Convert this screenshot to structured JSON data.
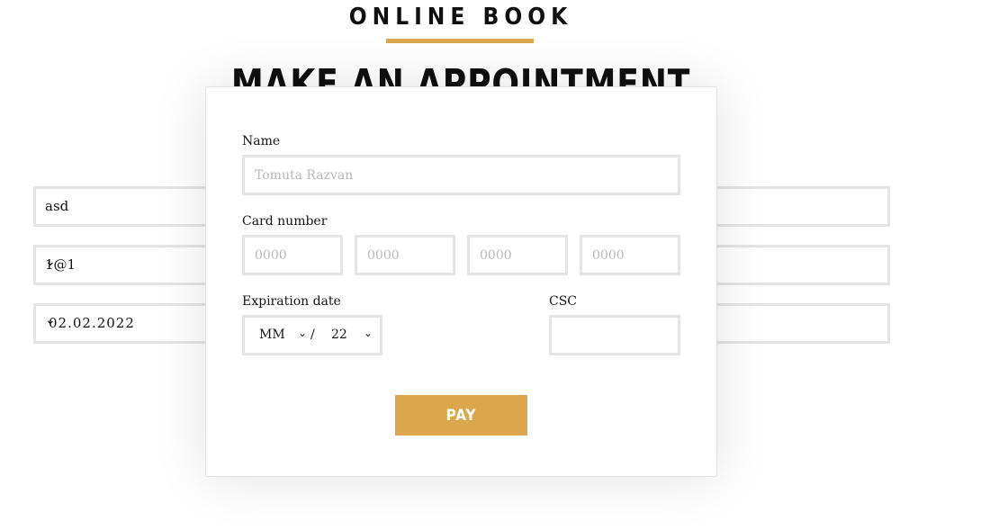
{
  "background": {
    "title": "ONLINE BOOK",
    "heading": "MAKE AN APPOINTMENT",
    "fields": {
      "name_value": "asd",
      "email_value": "1@1",
      "date_value": "02.02.2022"
    },
    "accent_color": "#d9a64b"
  },
  "modal": {
    "name_label": "Name",
    "name_placeholder": "Tomuta Razvan",
    "card_label": "Card number",
    "card_placeholders": [
      "0000",
      "0000",
      "0000",
      "0000"
    ],
    "expiration_label": "Expiration date",
    "expiration_month": "MM",
    "expiration_separator": "/",
    "expiration_year": "22",
    "csc_label": "CSC",
    "csc_value": "",
    "pay_label": "PAY",
    "pay_color": "#dca64c"
  }
}
